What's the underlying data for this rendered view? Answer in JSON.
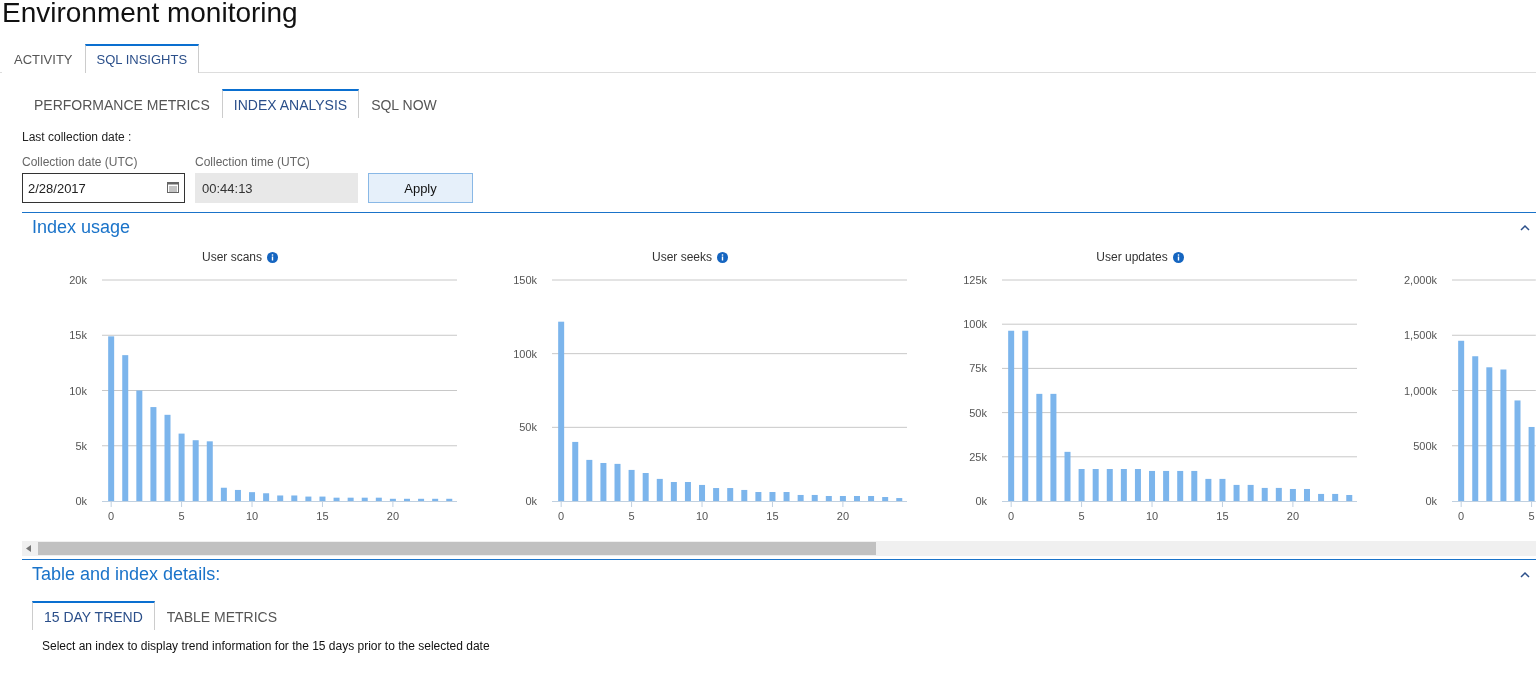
{
  "page_title": "Environment monitoring",
  "tabs": [
    {
      "label": "ACTIVITY",
      "selected": false
    },
    {
      "label": "SQL INSIGHTS",
      "selected": true
    }
  ],
  "subtabs": [
    {
      "label": "PERFORMANCE METRICS",
      "selected": false
    },
    {
      "label": "INDEX ANALYSIS",
      "selected": true
    },
    {
      "label": "SQL NOW",
      "selected": false
    }
  ],
  "last_collection": {
    "label": "Last collection date :"
  },
  "collection_date": {
    "label": "Collection date (UTC)",
    "value": "2/28/2017"
  },
  "collection_time": {
    "label": "Collection time (UTC)",
    "value": "00:44:13",
    "disabled": true
  },
  "apply_button": "Apply",
  "index_usage": {
    "title": "Index usage",
    "expanded": true,
    "charts": [
      {
        "title": "User scans",
        "chart_data": {
          "type": "bar",
          "x": [
            0,
            1,
            2,
            3,
            4,
            5,
            6,
            7,
            8,
            9,
            10,
            11,
            12,
            13,
            14,
            15,
            16,
            17,
            18,
            19,
            20,
            21,
            22,
            23,
            24
          ],
          "values": [
            14900,
            13200,
            10000,
            8500,
            7800,
            6100,
            5500,
            5400,
            1200,
            1000,
            800,
            700,
            500,
            500,
            400,
            400,
            300,
            300,
            300,
            300,
            200,
            200,
            200,
            200,
            200
          ],
          "xlim": [
            -0.65,
            24.55
          ],
          "grid": true,
          "ylim": [
            0,
            20000
          ],
          "yticks": [
            {
              "value": 0,
              "label": "0k"
            },
            {
              "value": 5000,
              "label": "5k"
            },
            {
              "value": 10000,
              "label": "10k"
            },
            {
              "value": 15000,
              "label": "15k"
            },
            {
              "value": 20000,
              "label": "20k"
            }
          ],
          "xticks": [
            0,
            5,
            10,
            15,
            20
          ]
        }
      },
      {
        "title": "User seeks",
        "chart_data": {
          "type": "bar",
          "x": [
            0,
            1,
            2,
            3,
            4,
            5,
            6,
            7,
            8,
            9,
            10,
            11,
            12,
            13,
            14,
            15,
            16,
            17,
            18,
            19,
            20,
            21,
            22,
            23,
            24
          ],
          "values": [
            121700,
            40100,
            27900,
            25800,
            25200,
            21100,
            19000,
            15000,
            12900,
            12900,
            10900,
            8800,
            8800,
            7500,
            6100,
            6100,
            6100,
            4100,
            4100,
            3400,
            3400,
            3400,
            3400,
            2700,
            2000
          ],
          "xlim": [
            -0.65,
            24.55
          ],
          "grid": true,
          "ylim": [
            0,
            150000
          ],
          "yticks": [
            {
              "value": 0,
              "label": "0k"
            },
            {
              "value": 50000,
              "label": "50k"
            },
            {
              "value": 100000,
              "label": "100k"
            },
            {
              "value": 150000,
              "label": "150k"
            }
          ],
          "xticks": [
            0,
            5,
            10,
            15,
            20
          ]
        }
      },
      {
        "title": "User updates",
        "chart_data": {
          "type": "bar",
          "x": [
            0,
            1,
            2,
            3,
            4,
            5,
            6,
            7,
            8,
            9,
            10,
            11,
            12,
            13,
            14,
            15,
            16,
            17,
            18,
            19,
            20,
            21,
            22,
            23,
            24
          ],
          "values": [
            96300,
            96300,
            60600,
            60600,
            27800,
            18100,
            18100,
            18100,
            18100,
            18100,
            17000,
            17000,
            17000,
            17000,
            12500,
            12500,
            9100,
            9100,
            7400,
            7400,
            6800,
            6800,
            4000,
            4000,
            3400
          ],
          "xlim": [
            -0.65,
            24.55
          ],
          "grid": true,
          "ylim": [
            0,
            125000
          ],
          "yticks": [
            {
              "value": 0,
              "label": "0k"
            },
            {
              "value": 25000,
              "label": "25k"
            },
            {
              "value": 50000,
              "label": "50k"
            },
            {
              "value": 75000,
              "label": "75k"
            },
            {
              "value": 100000,
              "label": "100k"
            },
            {
              "value": 125000,
              "label": "125k"
            }
          ],
          "xticks": [
            0,
            5,
            10,
            15,
            20
          ]
        }
      },
      {
        "chart_data": {
          "type": "bar",
          "x": [
            0,
            1,
            2,
            3,
            4,
            5
          ],
          "values": [
            1450000,
            1310000,
            1210000,
            1190000,
            910000,
            670000
          ],
          "xlim": [
            -0.65,
            5.3
          ],
          "grid": true,
          "ylim": [
            0,
            2000000
          ],
          "yticks": [
            {
              "value": 0,
              "label": "0k"
            },
            {
              "value": 500000,
              "label": "500k"
            },
            {
              "value": 1000000,
              "label": "1,000k"
            },
            {
              "value": 1500000,
              "label": "1,500k"
            },
            {
              "value": 2000000,
              "label": "2,000k"
            }
          ],
          "xticks": [
            0,
            5
          ]
        }
      }
    ]
  },
  "details": {
    "title": "Table and index details:",
    "expanded": true,
    "tabs": [
      {
        "label": "15 DAY TREND",
        "selected": true
      },
      {
        "label": "TABLE METRICS",
        "selected": false
      }
    ],
    "message": "Select an index to display trend information for the 15 days prior to the selected date"
  }
}
